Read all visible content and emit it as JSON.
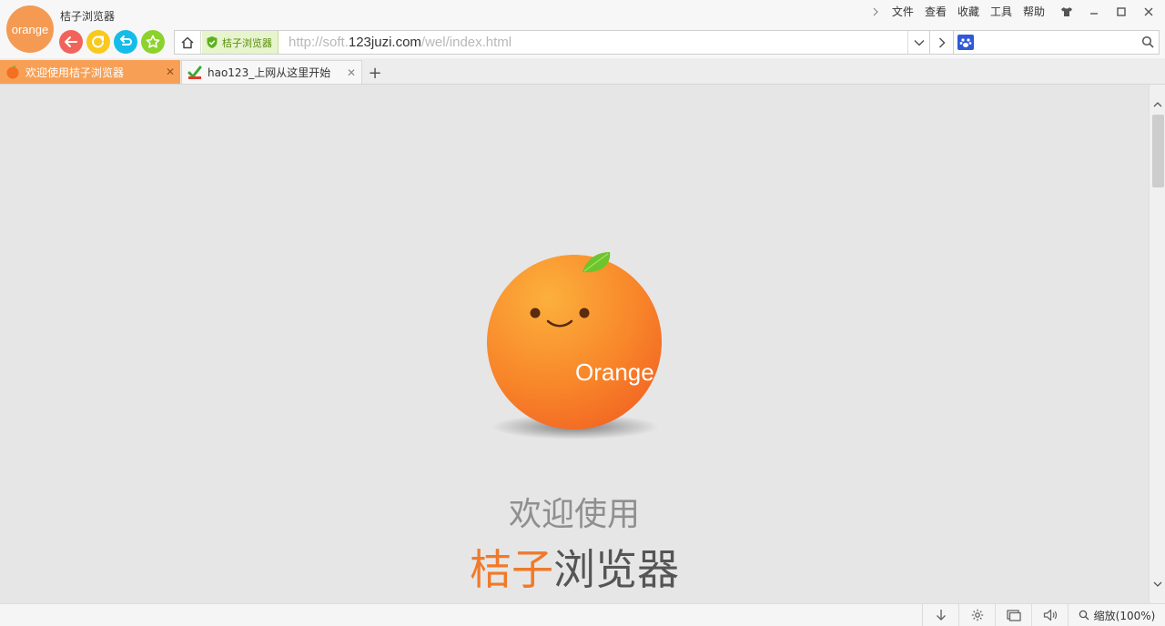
{
  "app": {
    "logo_text": "orange",
    "title": "桔子浏览器"
  },
  "menu": {
    "items": [
      "文件",
      "查看",
      "收藏",
      "工具",
      "帮助"
    ]
  },
  "address": {
    "security_label": "桔子浏览器",
    "url_prefix": "http://soft.",
    "url_domain": "123juzi.com",
    "url_path": "/wel/index.html"
  },
  "search": {
    "engine_label": "",
    "value": ""
  },
  "tabs": [
    {
      "label": "欢迎使用桔子浏览器",
      "active": true
    },
    {
      "label": "hao123_上网从这里开始",
      "active": false
    }
  ],
  "tab_new_label": "+",
  "page": {
    "mascot_text": "Orange",
    "welcome_line1": "欢迎使用",
    "welcome_accent": "桔子",
    "welcome_rest": "浏览器"
  },
  "status": {
    "zoom_label": "缩放(100%)"
  },
  "colors": {
    "accent": "#f07a2a",
    "tab_active": "#f7a055",
    "back": "#f0645b",
    "refresh": "#f8c91e",
    "undo": "#14bde9",
    "favorite": "#8cd22c"
  }
}
